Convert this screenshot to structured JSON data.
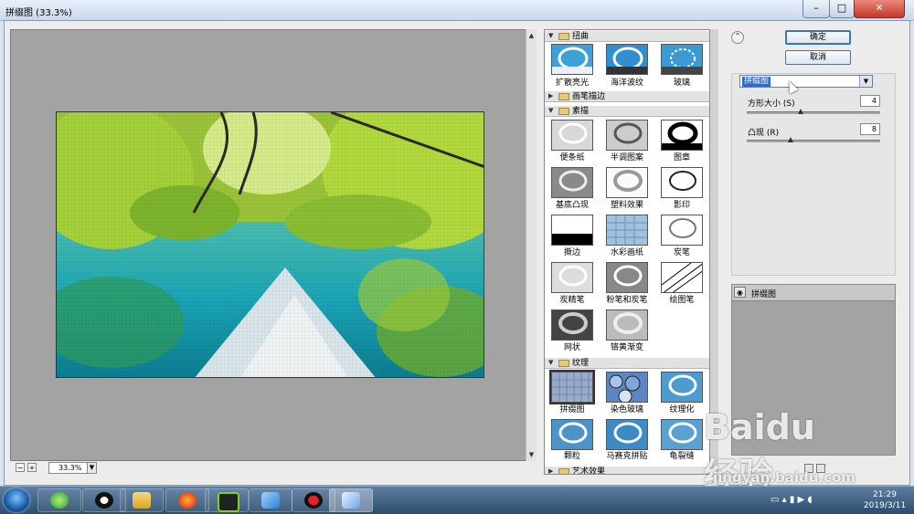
{
  "window": {
    "title": "拼缀图 (33.3%)"
  },
  "preview": {
    "zoom": "33.3%"
  },
  "gallery": {
    "categories": [
      {
        "name": "扭曲",
        "expanded": true,
        "filters": [
          "扩散亮光",
          "海洋波纹",
          "玻璃"
        ]
      },
      {
        "name": "画笔描边",
        "expanded": false,
        "filters": []
      },
      {
        "name": "素描",
        "expanded": true,
        "filters": [
          "便条纸",
          "半调图案",
          "图章",
          "基底凸现",
          "塑料效果",
          "影印",
          "撕边",
          "水彩画纸",
          "炭笔",
          "炭精笔",
          "粉笔和炭笔",
          "绘图笔",
          "网状",
          "铬黄渐变"
        ]
      },
      {
        "name": "纹理",
        "expanded": true,
        "filters": [
          "拼缀图",
          "染色玻璃",
          "纹理化",
          "颗粒",
          "马赛克拼贴",
          "龟裂缝"
        ]
      },
      {
        "name": "艺术效果",
        "expanded": false,
        "filters": []
      }
    ],
    "selected_filter": "拼缀图"
  },
  "buttons": {
    "ok": "确定",
    "cancel": "取消"
  },
  "settings": {
    "filter_select": "拼缀图",
    "params": [
      {
        "label": "方形大小 (S)",
        "value": "4",
        "slider_fraction": 0.4
      },
      {
        "label": "凸现 (R)",
        "value": "8",
        "slider_fraction": 0.32
      }
    ]
  },
  "layers": {
    "items": [
      "拼缀图"
    ]
  },
  "watermark": {
    "logo": "Baidu 经验",
    "url": "jingyan.baidu.com"
  },
  "taskbar": {
    "clock_time": "21:29",
    "clock_date": "2019/3/11"
  }
}
